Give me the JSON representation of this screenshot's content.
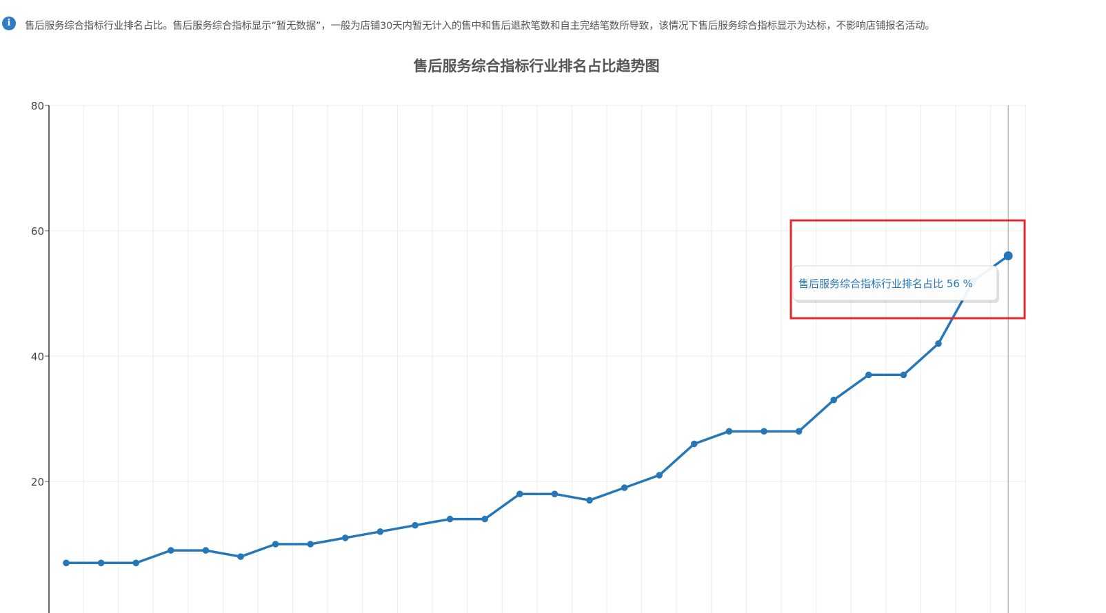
{
  "notice": {
    "icon": "info-icon",
    "text": "售后服务综合指标行业排名占比。售后服务综合指标显示”暂无数据”，一般为店铺30天内暂无计入的售中和售后退款笔数和自主完结笔数所导致，该情况下售后服务综合指标显示为达标，不影响店铺报名活动。"
  },
  "chart_data": {
    "type": "line",
    "title": "售后服务综合指标行业排名占比趋势图",
    "xlabel": "",
    "ylabel": "",
    "ylim": [
      0,
      80
    ],
    "yticks": [
      "20",
      "40",
      "60",
      "80"
    ],
    "grid": true,
    "series": [
      {
        "color": "#2677b8",
        "values": [
          7,
          7,
          7,
          9,
          9,
          8,
          10,
          10,
          11,
          12,
          13,
          14,
          14,
          18,
          18,
          17,
          19,
          21,
          26,
          28,
          28,
          28,
          33,
          37,
          37,
          42,
          52,
          56
        ]
      }
    ]
  },
  "tooltip": {
    "series_label": "售后服务综合指标行业排名占比",
    "value": "56 %",
    "highlight_color": "#e0292e"
  }
}
